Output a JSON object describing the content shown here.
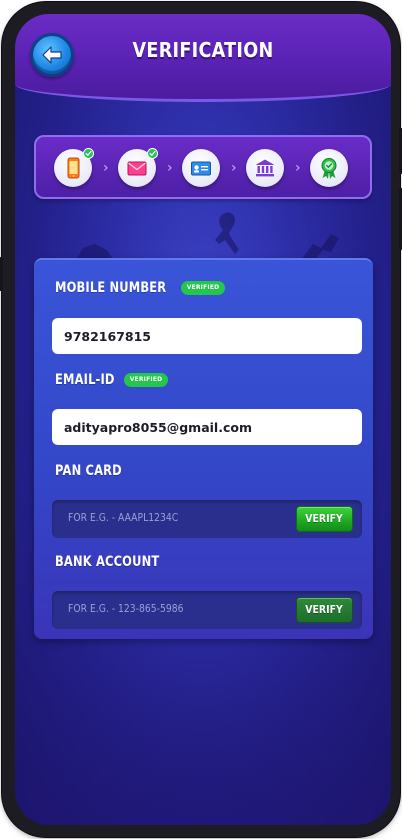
{
  "header": {
    "title": "VERIFICATION",
    "back_icon": "arrow-left-icon"
  },
  "stepper": {
    "steps": [
      {
        "icon": "mobile-phone-icon",
        "completed": true
      },
      {
        "icon": "envelope-icon",
        "completed": true
      },
      {
        "icon": "id-card-icon",
        "completed": false
      },
      {
        "icon": "bank-icon",
        "completed": false
      },
      {
        "icon": "award-badge-icon",
        "completed": false
      }
    ]
  },
  "form": {
    "mobile": {
      "label": "MOBILE NUMBER",
      "badge": "VERIFIED",
      "value": "9782167815"
    },
    "email": {
      "label": "EMAIL-ID",
      "badge": "VERIFIED",
      "value": "adityapro8055@gmail.com"
    },
    "pan": {
      "label": "PAN CARD",
      "placeholder": "FOR E.G. - AAAPL1234C",
      "button": "VERIFY"
    },
    "bank": {
      "label": "BANK ACCOUNT",
      "placeholder": "FOR E.G. - 123-865-5986",
      "button": "VERIFY"
    }
  },
  "colors": {
    "background": "#2d2ea8",
    "header": "#5a22b4",
    "card": "#3347c8",
    "verified_badge": "#24c64e",
    "verify_button": "#1ea823",
    "back_button": "#1f86e4"
  }
}
